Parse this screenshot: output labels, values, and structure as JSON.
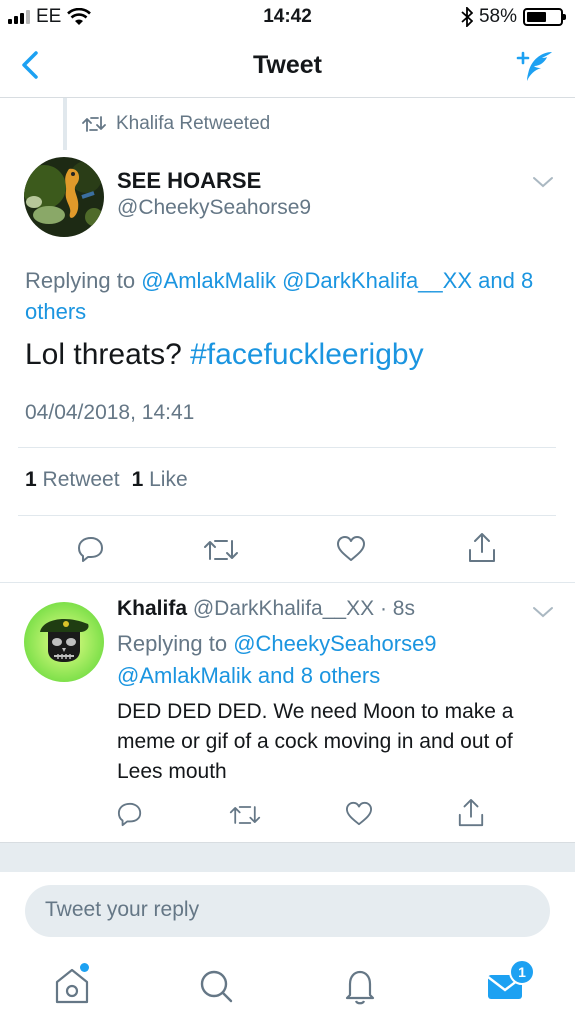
{
  "status_bar": {
    "carrier": "EE",
    "time": "14:42",
    "battery": "58%",
    "battery_level": 0.58
  },
  "nav": {
    "title": "Tweet"
  },
  "retweet_header": {
    "text": "Khalifa Retweeted"
  },
  "main_tweet": {
    "name": "SEE HOARSE",
    "handle": "@CheekySeahorse9",
    "replying_prefix": "Replying to",
    "replying_links": [
      "@AmlakMalik",
      "@DarkKhalifa__XX",
      "and 8 others"
    ],
    "text_plain": "Lol threats?",
    "text_hashtag": "#facefuckleerigby",
    "timestamp": "04/04/2018, 14:41",
    "retweet_count": "1",
    "retweet_label": "Retweet",
    "like_count": "1",
    "like_label": "Like"
  },
  "reply_tweet": {
    "name": "Khalifa",
    "handle": "@DarkKhalifa__XX",
    "time": "· 8s",
    "replying_prefix": "Replying to",
    "replying_link_1": "@CheekySeahorse9",
    "replying_link_2": "@AmlakMalik",
    "replying_link_3": "and 8 others",
    "text": "DED DED DED. We need Moon to make a meme or gif of a cock moving in and out of Lees mouth"
  },
  "reply_box": {
    "placeholder": "Tweet your reply"
  },
  "tab_bar": {
    "messages_badge": "1"
  },
  "colors": {
    "accent": "#1da1f2",
    "link": "#1b95e0",
    "secondary_text": "#657786",
    "band": "#e6ecf0"
  },
  "icons": [
    "back-chevron-icon",
    "compose-tweet-icon",
    "retweet-icon",
    "reply-icon",
    "like-icon",
    "share-icon",
    "home-icon",
    "search-icon",
    "notifications-icon",
    "messages-icon",
    "wifi-icon",
    "bluetooth-icon"
  ]
}
